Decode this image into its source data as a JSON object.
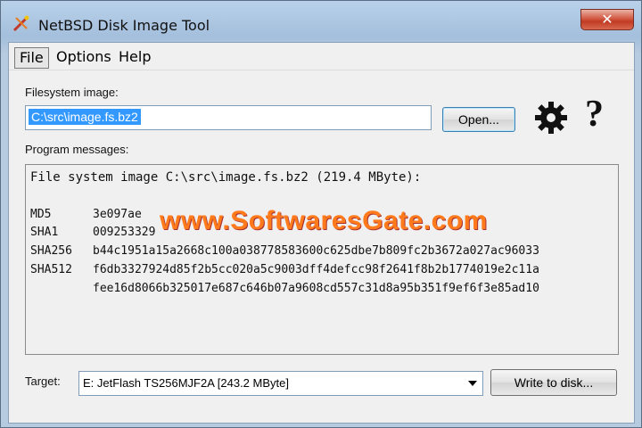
{
  "window": {
    "title": "NetBSD Disk Image Tool",
    "close_label": "✕"
  },
  "menu": {
    "file": "File",
    "options": "Options",
    "help": "Help"
  },
  "filesystem": {
    "label": "Filesystem image:",
    "value": "C:\\src\\image.fs.bz2",
    "open_label": "Open..."
  },
  "messages": {
    "label": "Program messages:",
    "header": "File system image C:\\src\\image.fs.bz2 (219.4 MByte):",
    "hashes": [
      {
        "name": "MD5",
        "value": "3e097ae"
      },
      {
        "name": "SHA1",
        "value": "009253329"
      },
      {
        "name": "SHA256",
        "value": "b44c1951a15a2668c100a038778583600c625dbe7b809fc2b3672a027ac96033"
      },
      {
        "name": "SHA512",
        "value": "f6db3327924d85f2b5cc020a5c9003dff4defcc98f2641f8b2b1774019e2c11a"
      }
    ],
    "sha512_cont": "fee16d8066b325017e687c646b07a9608cd557c31d8a95b351f9ef6f3e85ad10"
  },
  "watermark": "www.SoftwaresGate.com",
  "target": {
    "label": "Target:",
    "value": "E: JetFlash TS256MJF2A [243.2 MByte]",
    "write_label": "Write to disk..."
  },
  "icons": {
    "settings": "gear-icon",
    "help": "question-icon",
    "app": "disk-tool-icon"
  }
}
